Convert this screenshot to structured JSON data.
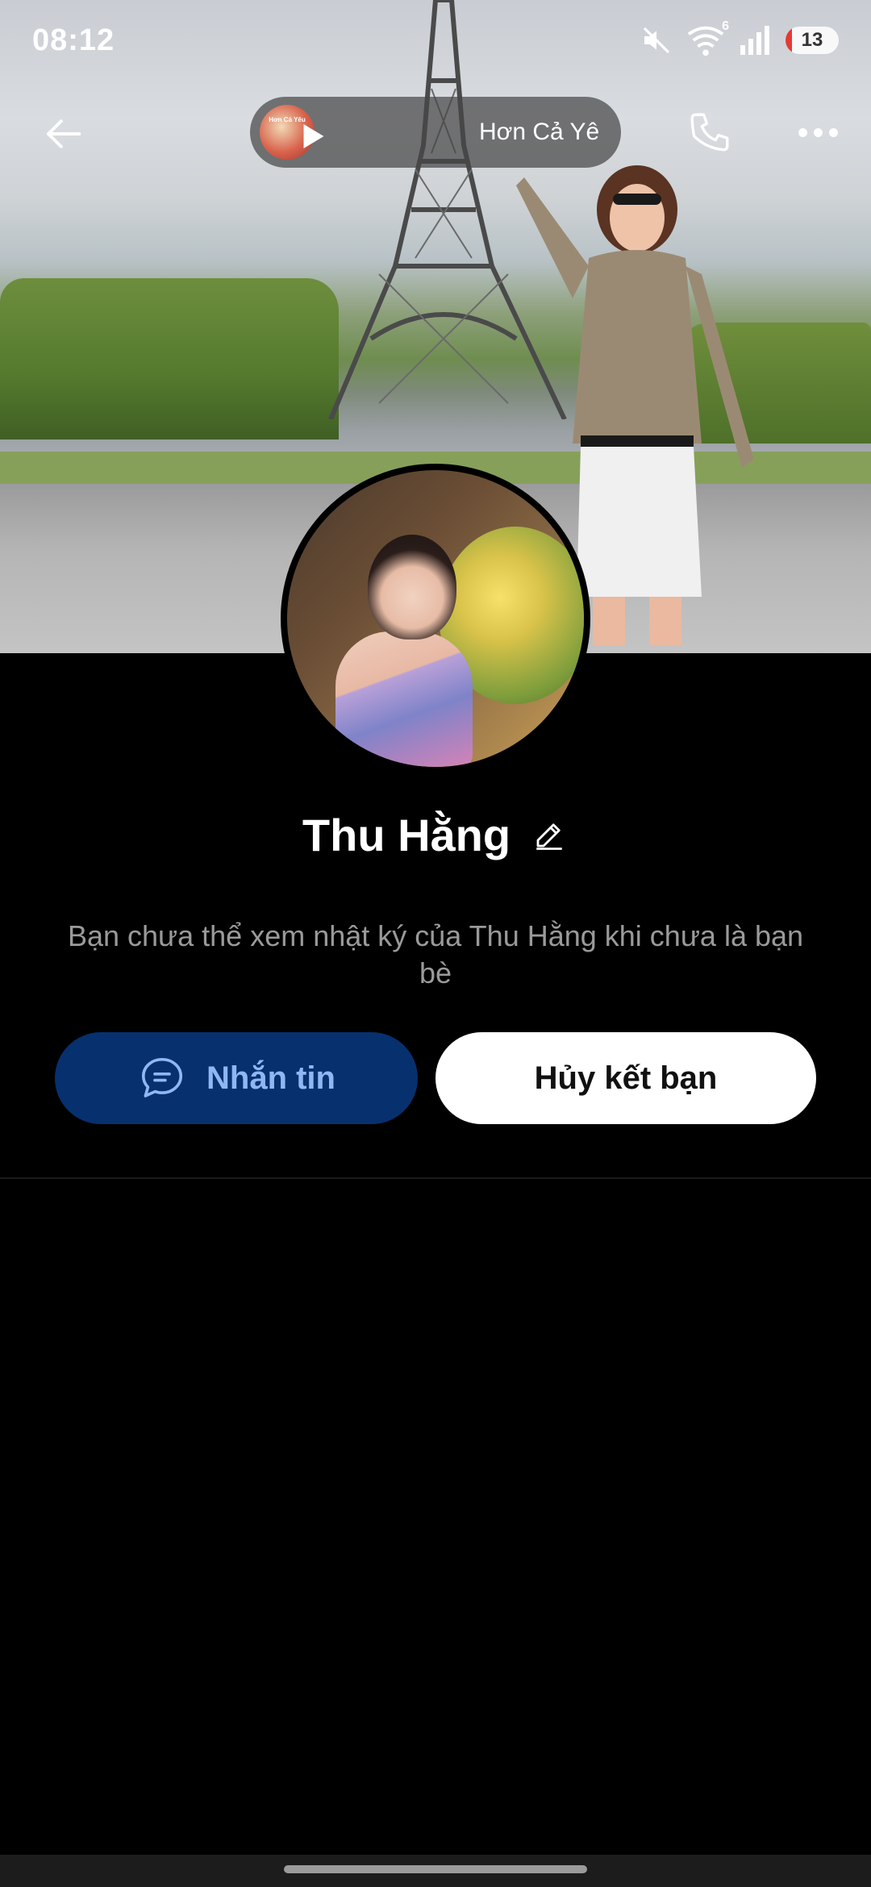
{
  "status_bar": {
    "time": "08:12",
    "wifi_badge": "6",
    "battery": "13",
    "icons": [
      "mute-icon",
      "wifi-icon",
      "signal-icon",
      "battery-icon"
    ]
  },
  "top_bar": {
    "music": {
      "thumb_text": "Hơn Cả Yêu",
      "title": "Hơn Cả Yê"
    },
    "icons": [
      "back-arrow-icon",
      "play-icon",
      "phone-icon",
      "more-icon"
    ]
  },
  "profile": {
    "name": "Thu Hằng",
    "notice": "Bạn chưa thể xem nhật ký của Thu Hằng khi chưa là bạn bè"
  },
  "actions": {
    "message_label": "Nhắn tin",
    "unfriend_label": "Hủy kết bạn"
  },
  "colors": {
    "message_button_bg": "#07306e",
    "message_button_text": "#8fb7f2",
    "background": "#000000",
    "notice_text": "#9a9a9a"
  }
}
